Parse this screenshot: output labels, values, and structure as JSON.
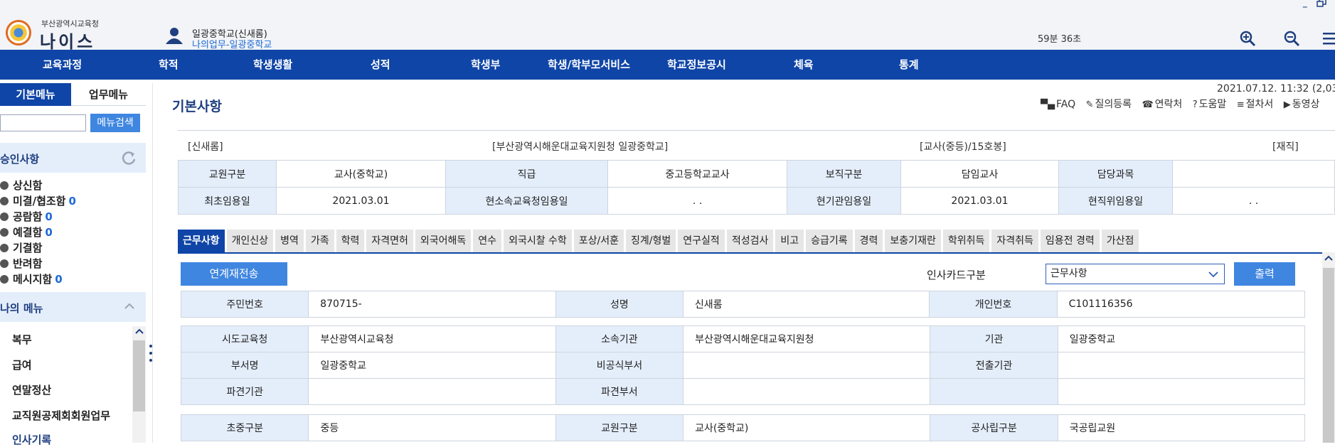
{
  "header": {
    "org_name": "부산광역시교육청",
    "app_name": "나이스",
    "user_name": "일광중학교(신새롬)",
    "user_work": "나의업무-일광중학교",
    "session_timer": "59분 36초",
    "window_min": "–",
    "icons": [
      "user-icon",
      "zoom-in-icon",
      "zoom-out-icon",
      "menu-icon"
    ]
  },
  "topnav": {
    "items": [
      "교육과정",
      "학적",
      "학생생활",
      "성적",
      "학생부",
      "학생/학부모서비스",
      "학교정보공시",
      "체육",
      "통계"
    ]
  },
  "sidebar": {
    "tab_basic": "기본메뉴",
    "tab_work": "업무메뉴",
    "search_placeholder": "",
    "search_button": "메뉴검색",
    "approval_title": "승인사항",
    "approval_items": [
      {
        "label": "상신함",
        "count": ""
      },
      {
        "label": "미결/협조함",
        "count": "0"
      },
      {
        "label": "공람함",
        "count": "0"
      },
      {
        "label": "예결함",
        "count": "0"
      },
      {
        "label": "기결함",
        "count": ""
      },
      {
        "label": "반려함",
        "count": ""
      },
      {
        "label": "메시지함",
        "count": "0"
      }
    ],
    "mymenu_title": "나의 메뉴",
    "mymenu_items": [
      "복무",
      "급여",
      "연말정산",
      "교직원공제회회원업무",
      "인사기록"
    ]
  },
  "main": {
    "page_title": "기본사항",
    "datetime": "2021.07.12. 11:32 (2,03",
    "toolbar": [
      {
        "icon": "faq-icon",
        "glyph": "▀▄",
        "label": "FAQ"
      },
      {
        "icon": "pencil-icon",
        "glyph": "✎",
        "label": "질의등록"
      },
      {
        "icon": "phone-icon",
        "glyph": "☎",
        "label": "연락처"
      },
      {
        "icon": "help-icon",
        "glyph": "?",
        "label": "도움말"
      },
      {
        "icon": "procedure-icon",
        "glyph": "≡",
        "label": "절차서"
      },
      {
        "icon": "video-icon",
        "glyph": "▶",
        "label": "동영상"
      }
    ],
    "summary": {
      "name": "[신새롬]",
      "school": "[부산광역시해운대교육지원청 일광중학교]",
      "rank": "[교사(중등)/15호봉]",
      "status": "[재직]"
    },
    "summary_rows": [
      [
        "교원구분",
        "교사(중학교)",
        "직급",
        "중고등학교교사",
        "보직구분",
        "담임교사",
        "담당과목",
        ""
      ],
      [
        "최초임용일",
        "2021.03.01",
        "현소속교육청임용일",
        ". .",
        "현기관임용일",
        "2021.03.01",
        "현직위임용일",
        ". ."
      ]
    ],
    "tabs": [
      "근무사항",
      "개인신상",
      "병역",
      "가족",
      "학력",
      "자격면허",
      "외국어해독",
      "연수",
      "외국시찰 수학",
      "포상/서훈",
      "징계/형벌",
      "연구실적",
      "적성검사",
      "비고",
      "승급기록",
      "경력",
      "보충기재란",
      "학위취득",
      "자격취득",
      "임용전 경력",
      "가산점"
    ],
    "active_tab": "근무사항",
    "resend_button": "연계재전송",
    "card_type_label": "인사카드구분",
    "card_type_value": "근무사항",
    "print_button": "출력",
    "detail_person": [
      [
        "주민번호",
        "870715-",
        "성명",
        "신새롬",
        "개인번호",
        "C101116356"
      ]
    ],
    "detail_org": [
      [
        "시도교육청",
        "부산광역시교육청",
        "소속기관",
        "부산광역시해운대교육지원청",
        "기관",
        "일광중학교"
      ],
      [
        "부서명",
        "일광중학교",
        "비공식부서",
        "",
        "전출기관",
        ""
      ],
      [
        "파견기관",
        "",
        "파견부서",
        "",
        "",
        ""
      ]
    ],
    "detail_type": [
      [
        "초중구분",
        "중등",
        "교원구분",
        "교사(중학교)",
        "공사립구분",
        "국공립교원"
      ]
    ]
  },
  "colors": {
    "nav_blue": "#0f45a7",
    "button_blue": "#3f86e0",
    "label_bg": "#e4eefb",
    "link_blue": "#1d6ad6"
  }
}
